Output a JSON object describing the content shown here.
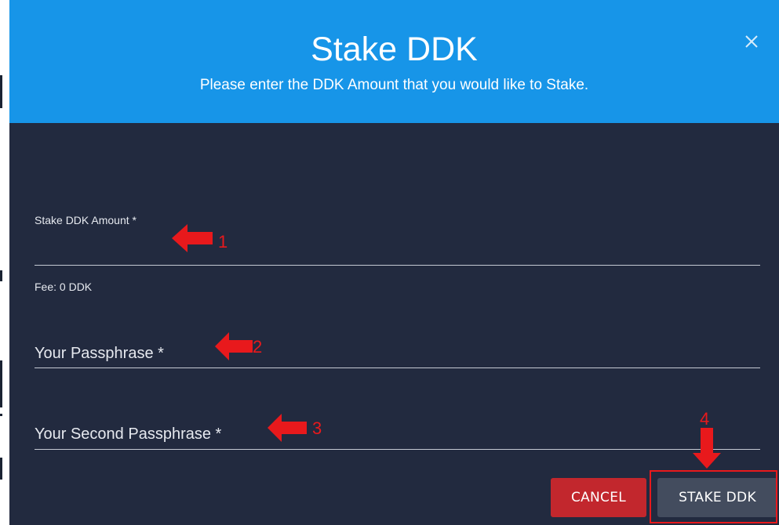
{
  "dialog": {
    "title": "Stake DDK",
    "subtitle": "Please enter the DDK Amount that you would like to Stake.",
    "close_icon": "close-icon"
  },
  "form": {
    "amount_label": "Stake DDK Amount *",
    "amount_value": "",
    "fee_text": "Fee: 0 DDK",
    "passphrase_label": "Your Passphrase *",
    "second_passphrase_label": "Your Second Passphrase *"
  },
  "actions": {
    "cancel_label": "CANCEL",
    "stake_label": "STAKE DDK"
  },
  "annotations": {
    "n1": "1",
    "n2": "2",
    "n3": "3",
    "n4": "4",
    "color": "#e8191c"
  },
  "colors": {
    "header": "#1795e8",
    "body": "#222a3f",
    "cancel": "#c2272d",
    "stake": "#434c5e"
  }
}
